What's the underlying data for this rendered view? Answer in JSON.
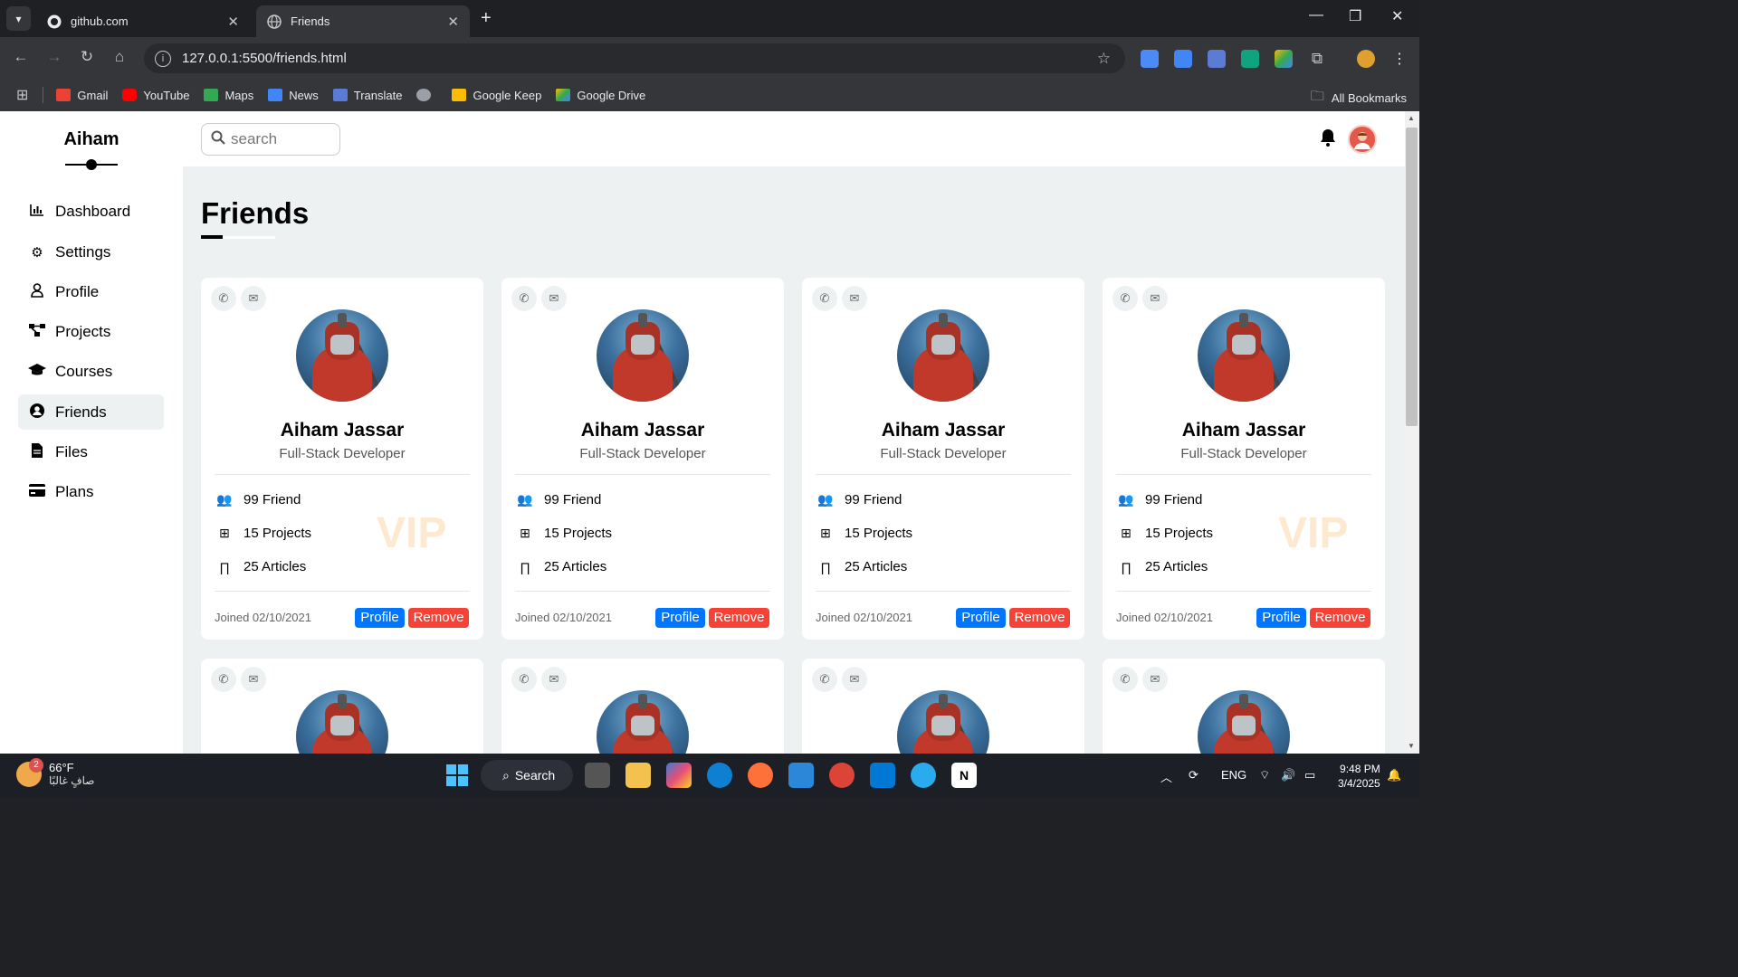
{
  "browser": {
    "tabs": [
      {
        "title": "github.com",
        "icon": "github-icon",
        "active": false
      },
      {
        "title": "Friends",
        "icon": "globe-icon",
        "active": true
      }
    ],
    "url": "127.0.0.1:5500/friends.html",
    "bookmarks": [
      "Gmail",
      "YouTube",
      "Maps",
      "News",
      "Translate",
      "Google Keep",
      "Google Drive"
    ],
    "all_bookmarks": "All Bookmarks"
  },
  "sidebar": {
    "brand": "Aiham",
    "items": [
      {
        "label": "Dashboard",
        "icon": "chart-icon",
        "active": false
      },
      {
        "label": "Settings",
        "icon": "gear-icon",
        "active": false
      },
      {
        "label": "Profile",
        "icon": "user-icon",
        "active": false
      },
      {
        "label": "Projects",
        "icon": "diagram-icon",
        "active": false
      },
      {
        "label": "Courses",
        "icon": "graduation-cap-icon",
        "active": false
      },
      {
        "label": "Friends",
        "icon": "user-circle-icon",
        "active": true
      },
      {
        "label": "Files",
        "icon": "file-icon",
        "active": false
      },
      {
        "label": "Plans",
        "icon": "credit-card-icon",
        "active": false
      }
    ]
  },
  "topbar": {
    "search_placeholder": "search"
  },
  "main": {
    "title": "Friends",
    "cards": [
      {
        "name": "Aiham Jassar",
        "role": "Full-Stack Developer",
        "friends": "99 Friend",
        "projects": "15 Projects",
        "articles": "25 Articles",
        "vip": "VIP",
        "joined": "Joined 02/10/2021",
        "profile_btn": "Profile",
        "remove_btn": "Remove"
      },
      {
        "name": "Aiham Jassar",
        "role": "Full-Stack Developer",
        "friends": "99 Friend",
        "projects": "15 Projects",
        "articles": "25 Articles",
        "vip": "",
        "joined": "Joined 02/10/2021",
        "profile_btn": "Profile",
        "remove_btn": "Remove"
      },
      {
        "name": "Aiham Jassar",
        "role": "Full-Stack Developer",
        "friends": "99 Friend",
        "projects": "15 Projects",
        "articles": "25 Articles",
        "vip": "",
        "joined": "Joined 02/10/2021",
        "profile_btn": "Profile",
        "remove_btn": "Remove"
      },
      {
        "name": "Aiham Jassar",
        "role": "Full-Stack Developer",
        "friends": "99 Friend",
        "projects": "15 Projects",
        "articles": "25 Articles",
        "vip": "VIP",
        "joined": "Joined 02/10/2021",
        "profile_btn": "Profile",
        "remove_btn": "Remove"
      }
    ]
  },
  "taskbar": {
    "weather_temp": "66°F",
    "weather_cond": "صافٍ غالبًا",
    "weather_badge": "2",
    "search_label": "Search",
    "lang": "ENG",
    "time": "9:48 PM",
    "date": "3/4/2025"
  },
  "colors": {
    "accent_blue": "#0075ff",
    "remove_red": "#f44336",
    "page_bg": "#eef1f2",
    "vip_color": "#fde9cf"
  }
}
